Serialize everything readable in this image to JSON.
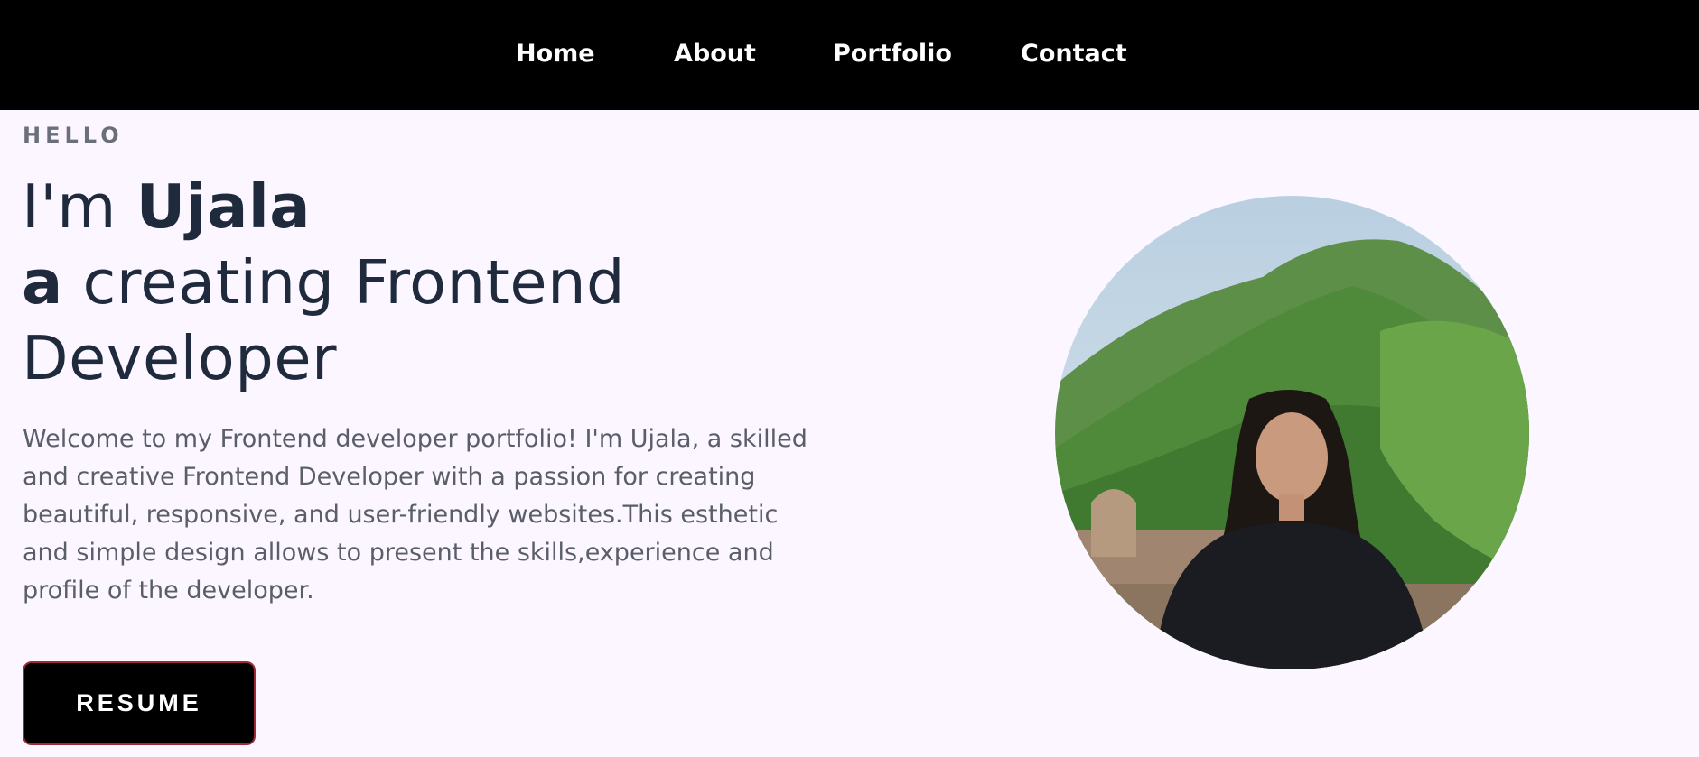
{
  "nav": {
    "items": [
      {
        "label": "Home"
      },
      {
        "label": "About"
      },
      {
        "label": "Portfolio"
      },
      {
        "label": "Contact"
      }
    ]
  },
  "hero": {
    "eyebrow": "HELLO",
    "headline_prefix": "I'm ",
    "name": "Ujala",
    "article": "a",
    "role_line": " creating Frontend",
    "role_line2": "Developer",
    "intro": "Welcome to my Frontend developer portfolio! I'm Ujala, a skilled and creative Frontend Developer with a passion for creating beautiful, responsive, and user-friendly websites.This esthetic and simple design allows to present the skills,experience and profile of the developer.",
    "resume_label": "RESUME",
    "avatar_alt": "Profile photo"
  },
  "colors": {
    "nav_bg": "#000000",
    "page_bg": "#fbf6ff",
    "heading": "#1f2a3c",
    "body_text": "#5a5e68",
    "button_border": "#9b2c35"
  }
}
